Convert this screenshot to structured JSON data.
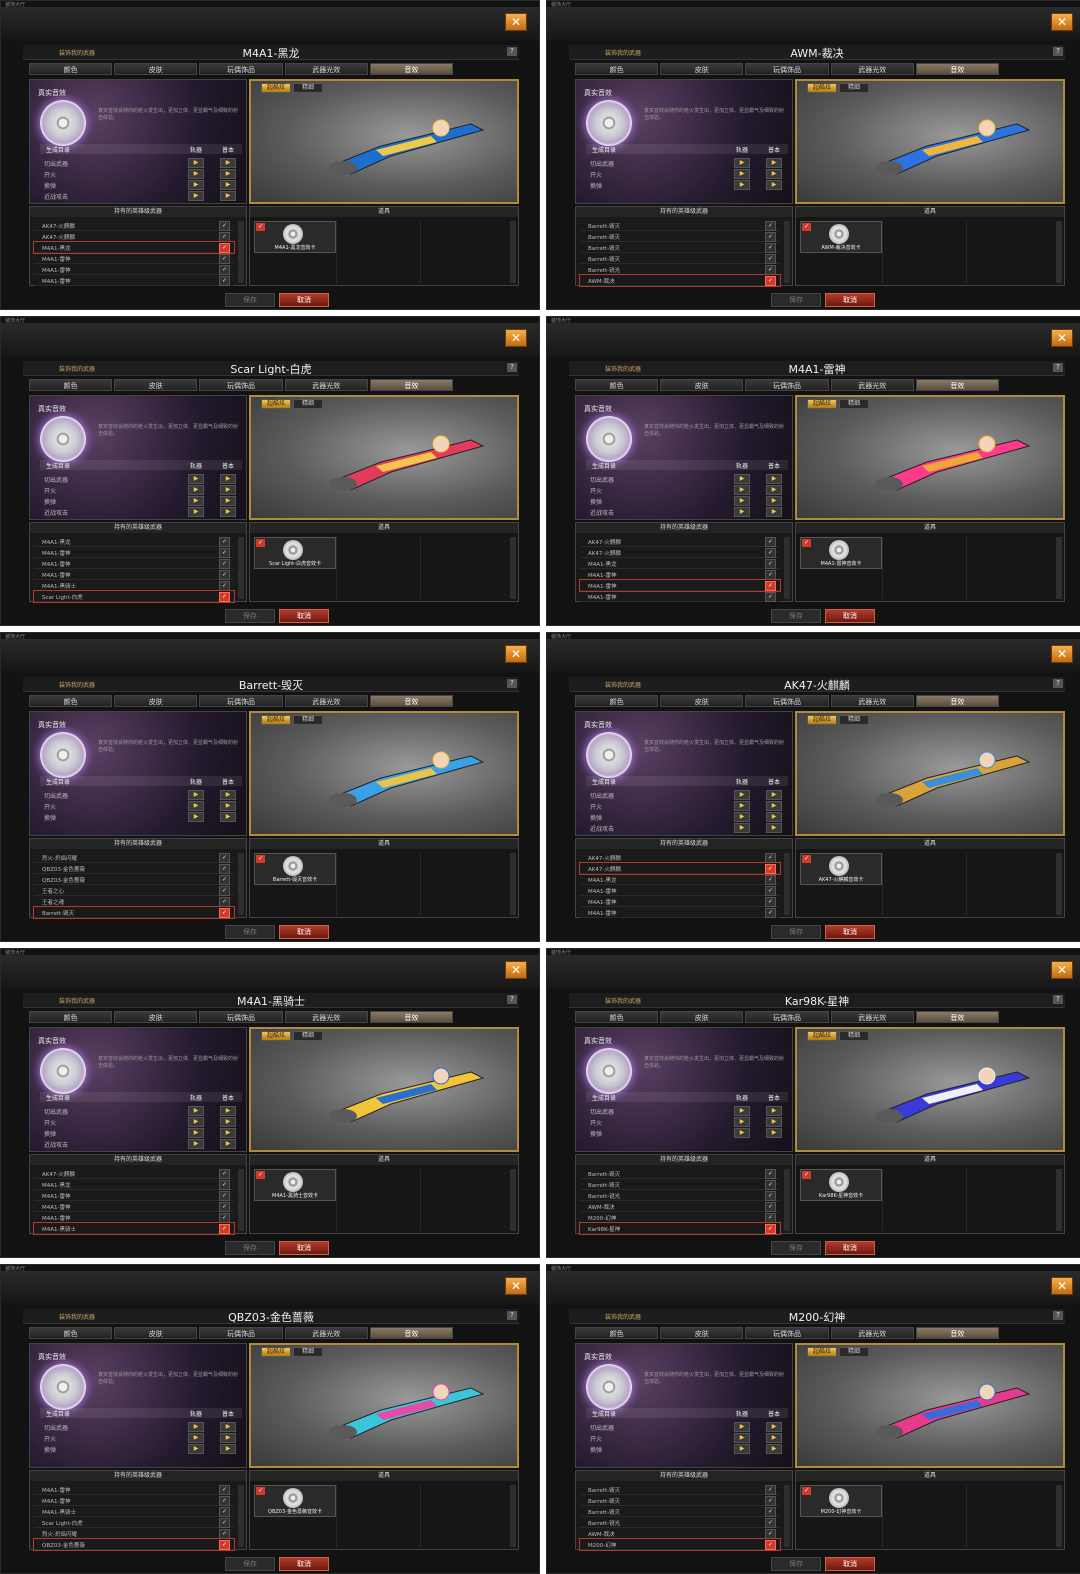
{
  "common": {
    "caption": "装饰大厅",
    "header_left": "装饰我的武器",
    "help": "?",
    "tabs": [
      "颜色",
      "皮肤",
      "玩偶饰品",
      "武器光效",
      "音效"
    ],
    "sound_box_title": "真实音效",
    "sound_box_desc": "真实音效会随你的枪火发生出，更加立体、更显霸气及细致的射击体验。",
    "sound_header": [
      "生成目录",
      "轨器",
      "普本"
    ],
    "preview_tabs": [
      "超酷炫",
      "精细"
    ],
    "list_title": "持有的英雄级武器",
    "items_title": "道具",
    "save": "保存",
    "cancel": "取消",
    "close": "✕",
    "check": "✓",
    "play": "▶"
  },
  "panels": [
    {
      "title": "M4A1-黑龙",
      "sounds": [
        "切出武器",
        "开火",
        "换弹",
        "近战攻击"
      ],
      "weapons": [
        "AK47-火麒麟",
        "AK47-火麒麟",
        "M4A1-黑龙",
        "M4A1-雷神",
        "M4A1-雷神",
        "M4A1-雷神"
      ],
      "selected": 2,
      "card": "M4A1-黑龙音效卡",
      "colors": [
        "#1c6fd1",
        "#f1c94a"
      ]
    },
    {
      "title": "AWM-裁决",
      "sounds": [
        "切出武器",
        "开火",
        "换弹"
      ],
      "weapons": [
        "Barrett-毁灭",
        "Barrett-毁灭",
        "Barrett-毁灭",
        "Barrett-毁灭",
        "Barrett-锐光",
        "AWM-裁决"
      ],
      "selected": 5,
      "card": "AWM-裁决音效卡",
      "colors": [
        "#2a73e0",
        "#f0b53e"
      ]
    },
    {
      "title": "Scar Light-白虎",
      "sounds": [
        "切出武器",
        "开火",
        "换弹",
        "近战攻击"
      ],
      "weapons": [
        "M4A1-黑龙",
        "M4A1-雷神",
        "M4A1-雷神",
        "M4A1-雷神",
        "M4A1-黑骑士",
        "Scar Light-白虎"
      ],
      "selected": 5,
      "card": "Scar Light-白虎音效卡",
      "colors": [
        "#e23b5c",
        "#f4c44c"
      ]
    },
    {
      "title": "M4A1-雷神",
      "sounds": [
        "切出武器",
        "开火",
        "换弹",
        "近战攻击"
      ],
      "weapons": [
        "AK47-火麒麟",
        "AK47-火麒麟",
        "M4A1-黑龙",
        "M4A1-雷神",
        "M4A1-雷神",
        "M4A1-雷神"
      ],
      "selected": 4,
      "card": "M4A1-雷神音效卡",
      "colors": [
        "#ff3a8a",
        "#f1a63a"
      ]
    },
    {
      "title": "Barrett-毁灭",
      "sounds": [
        "切出武器",
        "开火",
        "换弹"
      ],
      "weapons": [
        "烈火-炽焰闪耀",
        "QBZ03-金色蔷薇",
        "QBZ03-金色蔷薇",
        "王者之心",
        "王者之魂",
        "Barrett-毁灭"
      ],
      "selected": 5,
      "card": "Barrett-毁灭音效卡",
      "colors": [
        "#3aa0e8",
        "#e8c24a"
      ]
    },
    {
      "title": "AK47-火麒麟",
      "sounds": [
        "切出武器",
        "开火",
        "换弹",
        "近战攻击"
      ],
      "weapons": [
        "AK47-火麒麟",
        "AK47-火麒麟",
        "M4A1-黑龙",
        "M4A1-雷神",
        "M4A1-雷神",
        "M4A1-雷神"
      ],
      "selected": 1,
      "card": "AK47-火麒麟音效卡",
      "colors": [
        "#d9a23a",
        "#3a8fd8"
      ]
    },
    {
      "title": "M4A1-黑骑士",
      "sounds": [
        "切出武器",
        "开火",
        "换弹",
        "近战攻击"
      ],
      "weapons": [
        "AK47-火麒麟",
        "M4A1-黑龙",
        "M4A1-雷神",
        "M4A1-雷神",
        "M4A1-雷神",
        "M4A1-黑骑士"
      ],
      "selected": 5,
      "card": "M4A1-黑骑士音效卡",
      "colors": [
        "#f1c53a",
        "#2a6fd0"
      ]
    },
    {
      "title": "Kar98K-星神",
      "sounds": [
        "切出武器",
        "开火",
        "换弹"
      ],
      "weapons": [
        "Barrett-毁灭",
        "Barrett-毁灭",
        "Barrett-锐光",
        "AWM-裁决",
        "M200-幻神",
        "Kar98K-星神"
      ],
      "selected": 5,
      "card": "Kar98K-星神音效卡",
      "colors": [
        "#3a3ad8",
        "#f0f0f0"
      ]
    },
    {
      "title": "QBZ03-金色蔷薇",
      "sounds": [
        "切出武器",
        "开火",
        "换弹"
      ],
      "weapons": [
        "M4A1-雷神",
        "M4A1-雷神",
        "M4A1-黑骑士",
        "Scar Light-白虎",
        "烈火-炽焰闪耀",
        "QBZ03-金色蔷薇"
      ],
      "selected": 5,
      "card": "QBZ03-金色蔷薇音效卡",
      "colors": [
        "#3ac6d8",
        "#e84aa8"
      ]
    },
    {
      "title": "M200-幻神",
      "sounds": [
        "切出武器",
        "开火",
        "换弹"
      ],
      "weapons": [
        "Barrett-毁灭",
        "Barrett-毁灭",
        "Barrett-毁灭",
        "Barrett-锐光",
        "AWM-裁决",
        "M200-幻神"
      ],
      "selected": 5,
      "card": "M200-幻神音效卡",
      "colors": [
        "#e83a8a",
        "#3a6ad8"
      ]
    }
  ]
}
